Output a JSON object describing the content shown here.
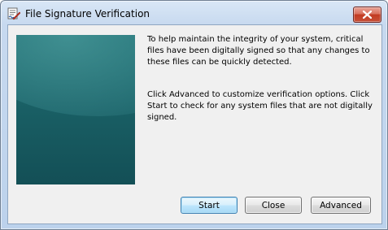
{
  "window": {
    "title": "File Signature Verification",
    "icon": "signature-verification-app-icon"
  },
  "titlebar": {
    "close_icon": "close-icon"
  },
  "content": {
    "intro_text": "To help maintain the integrity of your system, critical files have been digitally signed so that any changes to these files can be quickly detected.",
    "hint_text": "Click Advanced to customize verification options. Click Start to check for any system files that are not digitally signed."
  },
  "buttons": {
    "start_label": "Start",
    "close_label": "Close",
    "advanced_label": "Advanced"
  },
  "colors": {
    "panel_teal": "#1a6166",
    "close_button_red": "#c7513a",
    "default_button_border": "#3c7fb1"
  }
}
